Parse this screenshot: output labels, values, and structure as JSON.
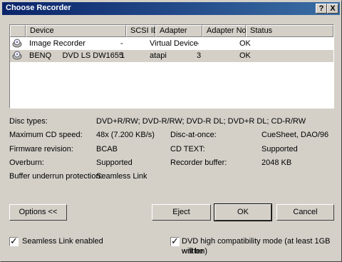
{
  "window": {
    "title": "Choose Recorder",
    "help_label": "?",
    "close_label": "X"
  },
  "list": {
    "columns": [
      "Device",
      "SCSI ID",
      "Adapter",
      "Adapter No.",
      "Status"
    ],
    "rows": [
      {
        "device": "Image Recorder",
        "scsi_id": "-",
        "adapter": "Virtual Device",
        "adapter_no": "-",
        "status": "OK",
        "icon": "image-recorder-icon"
      },
      {
        "device": "BENQ     DVD LS DW1655",
        "scsi_id": "1",
        "adapter": "atapi",
        "adapter_no": "3",
        "status": "OK",
        "icon": "optical-drive-icon",
        "selected": true
      }
    ]
  },
  "info": {
    "disc_types_label": "Disc types:",
    "disc_types_value": "DVD+R/RW; DVD-R/RW; DVD-R DL; DVD+R DL; CD-R/RW",
    "max_speed_label": "Maximum CD speed:",
    "max_speed_value": "48x (7.200 KB/s)",
    "dao_label": "Disc-at-once:",
    "dao_value": "CueSheet, DAO/96",
    "firmware_label": "Firmware revision:",
    "firmware_value": "BCAB",
    "cdtext_label": "CD TEXT:",
    "cdtext_value": "Supported",
    "overburn_label": "Overburn:",
    "overburn_value": "Supported",
    "buffer_label": "Recorder buffer:",
    "buffer_value": "2048 KB",
    "underrun_label": "Buffer underrun protection:",
    "underrun_value": "Seamless Link"
  },
  "buttons": {
    "options": "Options <<",
    "eject": "Eject",
    "ok": "OK",
    "cancel": "Cancel"
  },
  "options": {
    "seamless_label": "Seamless Link enabled",
    "seamless_checked": true,
    "dvd_compat_label_line1": "DVD high compatibility mode (at least 1GB will be",
    "dvd_compat_label_line2": "written)",
    "dvd_compat_checked": true,
    "check_glyph": "✓"
  },
  "colors": {
    "title_start": "#0a246a",
    "title_end": "#3a6ea5",
    "face": "#d4d0c8"
  }
}
